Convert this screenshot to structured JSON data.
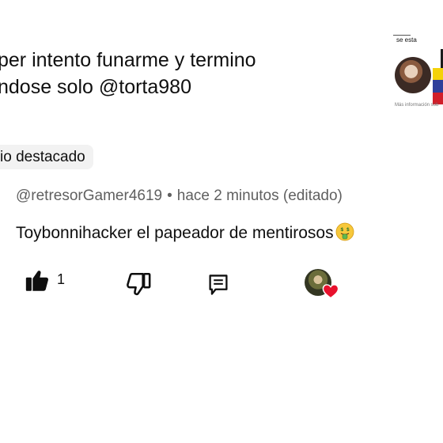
{
  "video": {
    "title_line1": "per intento funarme y termino",
    "title_line2": "ndose solo @torta980"
  },
  "thumbnail": {
    "top_text": "se esta",
    "more_info": "Más información sob"
  },
  "highlighted_chip": "io destacado",
  "comment": {
    "author": "@retresorGamer4619",
    "separator": "•",
    "time": "hace 2 minutos (editado)",
    "text": "Toybonnihacker el papeador de mentirosos",
    "emoji": "money-mouth-face",
    "like_count": "1"
  },
  "icons": {
    "like": "thumbs-up-icon",
    "dislike": "thumbs-down-icon",
    "reply": "comment-icon",
    "creator_heart": "heart-icon"
  },
  "colors": {
    "text": "#0f0f0f",
    "secondary": "#606060",
    "chip_bg": "#f2f2f2",
    "heart": "#e8112d"
  }
}
